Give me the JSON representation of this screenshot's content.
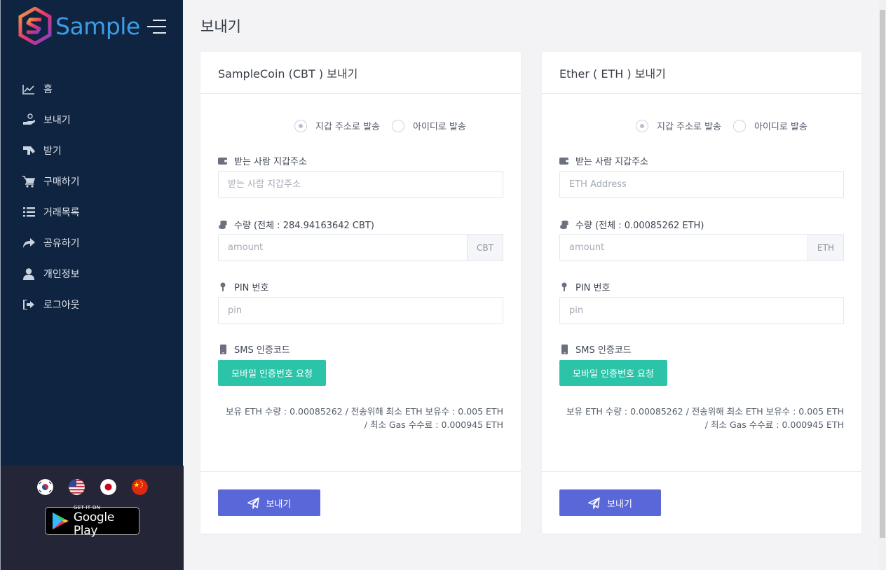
{
  "brand": {
    "name": "Sample"
  },
  "sidebar": {
    "items": [
      {
        "label": "홈",
        "icon": "chart-line-icon"
      },
      {
        "label": "보내기",
        "icon": "hand-coin-icon"
      },
      {
        "label": "받기",
        "icon": "receive-icon"
      },
      {
        "label": "구매하기",
        "icon": "cart-icon"
      },
      {
        "label": "거래목록",
        "icon": "list-icon"
      },
      {
        "label": "공유하기",
        "icon": "share-icon"
      },
      {
        "label": "개인정보",
        "icon": "user-icon"
      },
      {
        "label": "로그아웃",
        "icon": "logout-icon"
      }
    ],
    "languages": [
      "korean-flag-icon",
      "us-flag-icon",
      "japan-flag-icon",
      "china-flag-icon"
    ],
    "google_play": {
      "small": "GET IT ON",
      "big": "Google Play"
    }
  },
  "page_title": "보내기",
  "cards": [
    {
      "title": "SampleCoin (CBT ) 보내기",
      "radio_address": "지갑 주소로 발송",
      "radio_id": "아이디로 발송",
      "address_label": "받는 사람 지갑주소",
      "address_placeholder": "받는 사람 지갑주소",
      "amount_label": "수량 (전체 : 284.94163642 CBT)",
      "amount_placeholder": "amount",
      "amount_unit": "CBT",
      "pin_label": "PIN 번호",
      "pin_placeholder": "pin",
      "sms_label": "SMS 인증코드",
      "sms_button": "모바일 인증번호 요청",
      "note_line1": "보유 ETH 수량 : 0.00085262 / 전송위해 최소 ETH 보유수 : 0.005 ETH",
      "note_line2": "/ 최소 Gas 수수료 : 0.000945 ETH",
      "send_button": "보내기"
    },
    {
      "title": "Ether ( ETH ) 보내기",
      "radio_address": "지갑 주소로 발송",
      "radio_id": "아이디로 발송",
      "address_label": "받는 사람 지갑주소",
      "address_placeholder": "ETH Address",
      "amount_label": "수량 (전체 : 0.00085262 ETH)",
      "amount_placeholder": "amount",
      "amount_unit": "ETH",
      "pin_label": "PIN 번호",
      "pin_placeholder": "pin",
      "sms_label": "SMS 인증코드",
      "sms_button": "모바일 인증번호 요청",
      "note_line1": "보유 ETH 수량 : 0.00085262 / 전송위해 최소 ETH 보유수 : 0.005 ETH",
      "note_line2": "/ 최소 Gas 수수료 : 0.000945 ETH",
      "send_button": "보내기"
    }
  ],
  "colors": {
    "sidebar_bg": "#0e2440",
    "sidebar_bottom_bg": "#242637",
    "brand_blue": "#3d9ce6",
    "sms_button": "#2bc4a9",
    "send_button": "#5a67d8",
    "page_bg": "#f3f3f6"
  }
}
